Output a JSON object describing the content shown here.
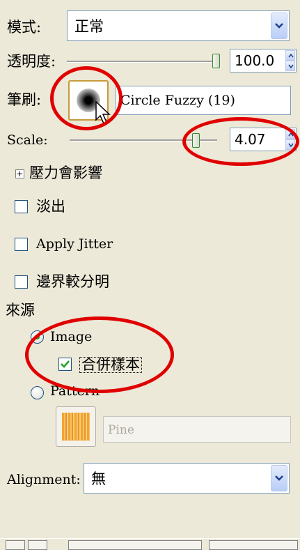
{
  "mode": {
    "label": "模式:",
    "value": "正常"
  },
  "opacity": {
    "label": "透明度:",
    "value": "100.0",
    "level": 1.0
  },
  "brush": {
    "label": "筆刷:",
    "name": "Circle Fuzzy (19)"
  },
  "scale": {
    "label": "Scale:",
    "value": "4.07",
    "level": 0.85
  },
  "pressure": {
    "label": "壓力會影響"
  },
  "fade": {
    "label": "淡出",
    "checked": false
  },
  "jitter": {
    "label": "Apply Jitter",
    "checked": false
  },
  "hard_edge": {
    "label": "邊界較分明",
    "checked": false
  },
  "source": {
    "heading": "來源",
    "image_label": "Image",
    "sample_merged_label": "合併樣本",
    "pattern_label": "Pattern",
    "pattern_name": "Pine"
  },
  "alignment": {
    "label": "Alignment:",
    "value": "無"
  },
  "colors": {
    "highlight_ring": "#e00000",
    "accent_green": "#21a121",
    "window_bg": "#ece9d8"
  }
}
